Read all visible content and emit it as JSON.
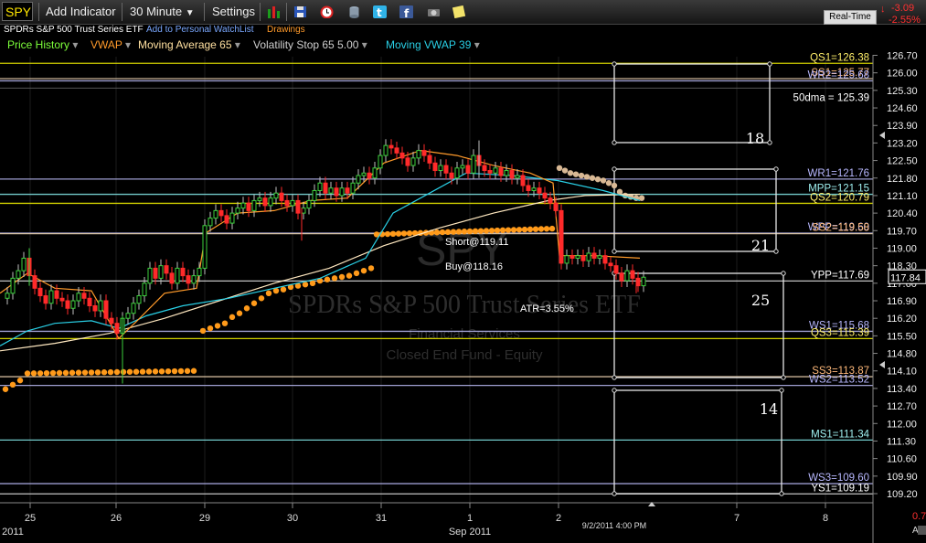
{
  "toolbar": {
    "symbol": "SPY",
    "add_indicator": "Add Indicator",
    "interval": "30 Minute",
    "settings": "Settings",
    "realtime": "Real-Time",
    "change": "-3.09",
    "change_pct": "-2.55%",
    "icons": [
      "bar-chart-icon",
      "save-icon",
      "alarm-clock-icon",
      "database-icon",
      "twitter-icon",
      "facebook-icon",
      "camera-icon",
      "note-icon"
    ]
  },
  "info": {
    "name": "SPDRs S&P 500 Trust Series ETF",
    "watchlist": "Add to Personal WatchList",
    "drawings": "Drawings"
  },
  "studies": [
    {
      "label": "Price History",
      "color": "#7dff3a"
    },
    {
      "label": "VWAP",
      "color": "#ff9a2a"
    },
    {
      "label": "Moving Average 65",
      "color": "#ffe0a0"
    },
    {
      "label": "Volatility Stop 65 5.00",
      "color": "#cfcfcf"
    },
    {
      "label": "Moving VWAP 39",
      "color": "#29d0e6"
    }
  ],
  "watermark": {
    "symbol": "SPY",
    "name": "SPDRs S&P 500 Trust Series ETF",
    "sector": "Financial Services",
    "type": "Closed End Fund - Equity"
  },
  "price_axis": [
    "126.70",
    "126.00",
    "125.30",
    "124.60",
    "123.90",
    "123.20",
    "122.50",
    "121.80",
    "121.10",
    "120.40",
    "119.70",
    "119.00",
    "118.30",
    "117.60",
    "116.90",
    "116.20",
    "115.50",
    "114.80",
    "114.10",
    "113.40",
    "112.70",
    "112.00",
    "111.30",
    "110.60",
    "109.90",
    "109.20"
  ],
  "current_price": "117.84",
  "bottom_right": {
    "top": "0.7",
    "bottom": "A"
  },
  "date_axis": [
    {
      "label": "25",
      "sub": "2011"
    },
    {
      "label": "26",
      "sub": ""
    },
    {
      "label": "29",
      "sub": ""
    },
    {
      "label": "30",
      "sub": ""
    },
    {
      "label": "31",
      "sub": ""
    },
    {
      "label": "1",
      "sub": "Sep 2011"
    },
    {
      "label": "2",
      "sub": ""
    },
    {
      "label": "7",
      "sub": ""
    },
    {
      "label": "8",
      "sub": ""
    }
  ],
  "cursor_time": "9/2/2011 4:00 PM",
  "levels": [
    {
      "label": "QS1=126.38",
      "price": 126.38,
      "color": "#e8e600",
      "text": "#ffef6a"
    },
    {
      "label": "SS1=125.77",
      "price": 125.77,
      "color": "#e0c8a8",
      "text": "#ffb97a"
    },
    {
      "label": "WR2=125.68",
      "price": 125.68,
      "color": "#b0b0e8",
      "text": "#b8b8ff"
    },
    {
      "label": "50dma = 125.39",
      "price": 125.39,
      "color": "#d8d8d8",
      "text": "#ffffff"
    },
    {
      "label": "WR1=121.76",
      "price": 121.76,
      "color": "#b0b0e8",
      "text": "#b8b8ff"
    },
    {
      "label": "MPP=121.15",
      "price": 121.15,
      "color": "#7fe0e0",
      "text": "#9ff0f0"
    },
    {
      "label": "QS2=120.79",
      "price": 120.79,
      "color": "#e8e600",
      "text": "#ffef6a"
    },
    {
      "label": "WPP=119.60",
      "price": 119.6,
      "color": "#b0b0e8",
      "text": "#b8b8ff"
    },
    {
      "label": "SS2=119.58",
      "price": 119.58,
      "color": "#e0c8a8",
      "text": "#ffb97a"
    },
    {
      "label": "YPP=117.69",
      "price": 117.69,
      "color": "#d8d8d8",
      "text": "#ffffff"
    },
    {
      "label": "WS1=115.68",
      "price": 115.68,
      "color": "#b0b0e8",
      "text": "#b8b8ff"
    },
    {
      "label": "QS3=115.39",
      "price": 115.39,
      "color": "#e8e600",
      "text": "#ffef6a"
    },
    {
      "label": "SS3=113.87",
      "price": 113.87,
      "color": "#e0c8a8",
      "text": "#ffb97a"
    },
    {
      "label": "WS2=113.52",
      "price": 113.52,
      "color": "#b0b0e8",
      "text": "#b8b8ff"
    },
    {
      "label": "MS1=111.34",
      "price": 111.34,
      "color": "#7fe0e0",
      "text": "#9ff0f0"
    },
    {
      "label": "WS3=109.60",
      "price": 109.6,
      "color": "#b0b0e8",
      "text": "#b8b8ff"
    },
    {
      "label": "YS1=109.19",
      "price": 109.19,
      "color": "#d8d8d8",
      "text": "#ffffff"
    }
  ],
  "annotations": {
    "short": "Short@119.11",
    "buy": "Buy@118.16",
    "atr": "ATR=3.55%"
  },
  "boxes": [
    "18",
    "21",
    "25",
    "14"
  ]
}
